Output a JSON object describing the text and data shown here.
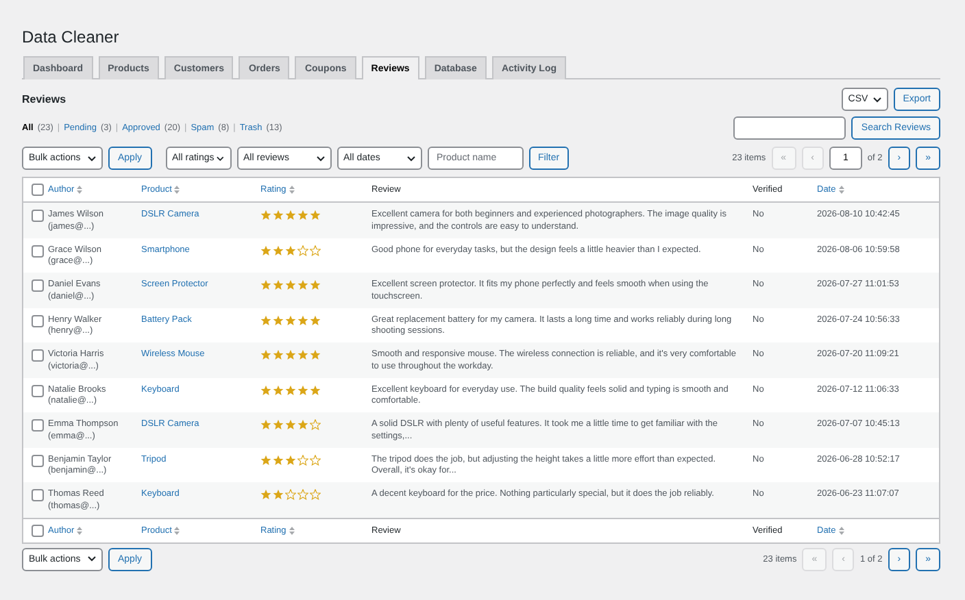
{
  "app_title": "Data Cleaner",
  "tabs": [
    {
      "label": "Dashboard",
      "selected": false
    },
    {
      "label": "Products",
      "selected": false
    },
    {
      "label": "Customers",
      "selected": false
    },
    {
      "label": "Orders",
      "selected": false
    },
    {
      "label": "Coupons",
      "selected": false
    },
    {
      "label": "Reviews",
      "selected": true
    },
    {
      "label": "Database",
      "selected": false
    },
    {
      "label": "Activity Log",
      "selected": false
    }
  ],
  "section_title": "Reviews",
  "export": {
    "format": "CSV",
    "button": "Export"
  },
  "status_filters": [
    {
      "label": "All",
      "count": "(23)",
      "selected": true
    },
    {
      "label": "Pending",
      "count": "(3)",
      "selected": false
    },
    {
      "label": "Approved",
      "count": "(20)",
      "selected": false
    },
    {
      "label": "Spam",
      "count": "(8)",
      "selected": false
    },
    {
      "label": "Trash",
      "count": "(13)",
      "selected": false
    }
  ],
  "status_separator": "|",
  "search_button": "Search Reviews",
  "header_select_all": {
    "checked": false
  },
  "footer_select_all": {
    "checked": false
  },
  "top_toolbar": {
    "bulk_actions": "Bulk actions",
    "apply": "Apply",
    "filters": [
      "All ratings",
      "All reviews",
      "All dates"
    ],
    "product_placeholder": "Product name",
    "filter_button": "Filter"
  },
  "pagination_top": {
    "items": "23 items",
    "first": "«",
    "prev": "‹",
    "page": "1",
    "of": "of 2",
    "next": "›",
    "last": "»",
    "first_disabled": true,
    "prev_disabled": true
  },
  "columns": [
    {
      "label": "Author",
      "sortable": true
    },
    {
      "label": "Product",
      "sortable": true
    },
    {
      "label": "Rating",
      "sortable": true
    },
    {
      "label": "Review",
      "sortable": false
    },
    {
      "label": "Verified",
      "sortable": false
    },
    {
      "label": "Date",
      "sortable": true
    }
  ],
  "rows": [
    {
      "author": "James Wilson",
      "email": "(james@...)",
      "product": "DSLR Camera",
      "stars": 5,
      "review": "Excellent camera for both beginners and experienced photographers. The image quality is impressive, and the controls are easy to understand.",
      "verified": "No",
      "date": "2026-08-10 10:42:45",
      "checked": false
    },
    {
      "author": "Grace Wilson",
      "email": "(grace@...)",
      "product": "Smartphone",
      "stars": 3,
      "review": "Good phone for everyday tasks, but the design feels a little heavier than I expected.",
      "verified": "No",
      "date": "2026-08-06 10:59:58",
      "checked": false
    },
    {
      "author": "Daniel Evans",
      "email": "(daniel@...)",
      "product": "Screen Protector",
      "stars": 5,
      "review": "Excellent screen protector. It fits my phone perfectly and feels smooth when using the touchscreen.",
      "verified": "No",
      "date": "2026-07-27 11:01:53",
      "checked": false
    },
    {
      "author": "Henry Walker",
      "email": "(henry@...)",
      "product": "Battery Pack",
      "stars": 5,
      "review": "Great replacement battery for my camera. It lasts a long time and works reliably during long shooting sessions.",
      "verified": "No",
      "date": "2026-07-24 10:56:33",
      "checked": false
    },
    {
      "author": "Victoria Harris",
      "email": "(victoria@...)",
      "product": "Wireless Mouse",
      "stars": 5,
      "review": "Smooth and responsive mouse. The wireless connection is reliable, and it's very comfortable to use throughout the workday.",
      "verified": "No",
      "date": "2026-07-20 11:09:21",
      "checked": false
    },
    {
      "author": "Natalie Brooks",
      "email": "(natalie@...)",
      "product": "Keyboard",
      "stars": 5,
      "review": "Excellent keyboard for everyday use. The build quality feels solid and typing is smooth and comfortable.",
      "verified": "No",
      "date": "2026-07-12 11:06:33",
      "checked": false
    },
    {
      "author": "Emma Thompson",
      "email": "(emma@...)",
      "product": "DSLR Camera",
      "stars": 4,
      "review": "A solid DSLR with plenty of useful features. It took me a little time to get familiar with the settings,...",
      "verified": "No",
      "date": "2026-07-07 10:45:13",
      "checked": false
    },
    {
      "author": "Benjamin Taylor",
      "email": "(benjamin@...)",
      "product": "Tripod",
      "stars": 3,
      "review": "The tripod does the job, but adjusting the height takes a little more effort than expected. Overall, it's okay for...",
      "verified": "No",
      "date": "2026-06-28 10:52:17",
      "checked": false
    },
    {
      "author": "Thomas Reed",
      "email": "(thomas@...)",
      "product": "Keyboard",
      "stars": 2,
      "review": "A decent keyboard for the price. Nothing particularly special, but it does the job reliably.",
      "verified": "No",
      "date": "2026-06-23 11:07:07",
      "checked": false
    }
  ],
  "footer_columns": [
    {
      "label": "Author",
      "sortable": true
    },
    {
      "label": "Product",
      "sortable": true
    },
    {
      "label": "Rating",
      "sortable": true
    },
    {
      "label": "Review",
      "sortable": false
    },
    {
      "label": "Verified",
      "sortable": false
    },
    {
      "label": "Date",
      "sortable": true
    }
  ],
  "bottom_toolbar": {
    "bulk_actions": "Bulk actions",
    "apply": "Apply"
  },
  "pagination_bottom": {
    "items": "23 items",
    "first": "«",
    "prev": "‹",
    "page": "1 of 2",
    "next": "›",
    "last": "»",
    "first_disabled": true,
    "prev_disabled": true
  }
}
